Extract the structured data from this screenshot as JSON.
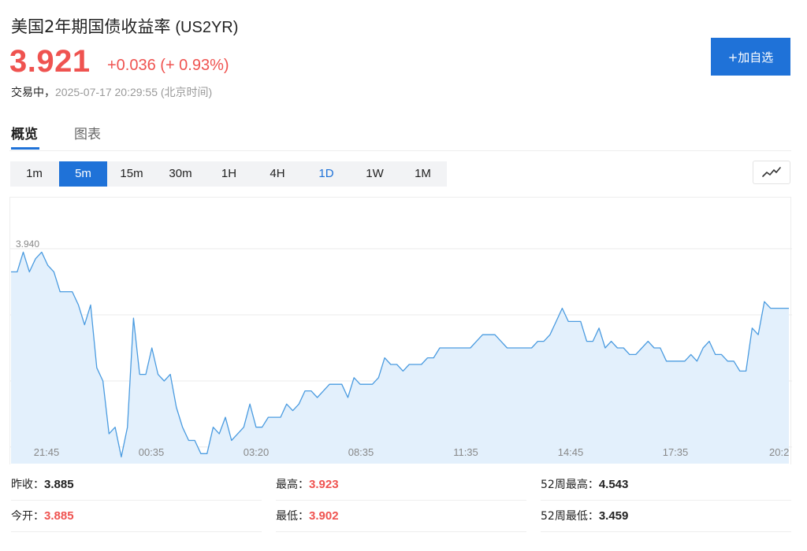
{
  "header": {
    "title": "美国2年期国债收益率",
    "code": "(US2YR)",
    "price": "3.921",
    "change": "+0.036 (+ 0.93%)",
    "status_live": "交易中，",
    "status_time": "2025-07-17 20:29:55 (北京时间)",
    "add_button": "+加自选"
  },
  "tabs": [
    {
      "label": "概览",
      "active": true
    },
    {
      "label": "图表",
      "active": false
    }
  ],
  "periods": [
    "1m",
    "5m",
    "15m",
    "30m",
    "1H",
    "4H",
    "1D",
    "1W",
    "1M"
  ],
  "selected_period": "5m",
  "highlight_period": "1D",
  "colors": {
    "up": "#ef5350",
    "accent": "#1f72d8",
    "line": "#4a9be0",
    "fill": "#e3f0fc"
  },
  "chart_data": {
    "type": "area",
    "y_ticks": [
      "3.940",
      "3.920",
      "3.900",
      "3.880"
    ],
    "x_ticks": [
      "21:45",
      "00:35",
      "03:20",
      "08:35",
      "11:35",
      "14:45",
      "17:35",
      "20:2"
    ],
    "ylim": [
      3.8745,
      3.9555
    ],
    "grid": true,
    "y": [
      3.933,
      3.933,
      3.939,
      3.933,
      3.937,
      3.939,
      3.935,
      3.933,
      3.927,
      3.927,
      3.927,
      3.923,
      3.917,
      3.923,
      3.904,
      3.9,
      3.884,
      3.886,
      3.877,
      3.886,
      3.919,
      3.902,
      3.902,
      3.91,
      3.902,
      3.9,
      3.902,
      3.892,
      3.886,
      3.882,
      3.882,
      3.878,
      3.878,
      3.886,
      3.884,
      3.889,
      3.882,
      3.884,
      3.886,
      3.893,
      3.886,
      3.886,
      3.889,
      3.889,
      3.889,
      3.893,
      3.891,
      3.893,
      3.897,
      3.897,
      3.895,
      3.897,
      3.899,
      3.899,
      3.899,
      3.895,
      3.901,
      3.899,
      3.899,
      3.899,
      3.901,
      3.907,
      3.905,
      3.905,
      3.903,
      3.905,
      3.905,
      3.905,
      3.907,
      3.907,
      3.91,
      3.91,
      3.91,
      3.91,
      3.91,
      3.91,
      3.912,
      3.914,
      3.914,
      3.914,
      3.912,
      3.91,
      3.91,
      3.91,
      3.91,
      3.91,
      3.912,
      3.912,
      3.914,
      3.918,
      3.922,
      3.918,
      3.918,
      3.918,
      3.912,
      3.912,
      3.916,
      3.91,
      3.912,
      3.91,
      3.91,
      3.908,
      3.908,
      3.91,
      3.912,
      3.91,
      3.91,
      3.906,
      3.906,
      3.906,
      3.906,
      3.908,
      3.906,
      3.91,
      3.912,
      3.908,
      3.908,
      3.906,
      3.906,
      3.903,
      3.903,
      3.916,
      3.914,
      3.924,
      3.922,
      3.922,
      3.922,
      3.922
    ]
  },
  "stats": [
    {
      "label": "昨收：",
      "value": "3.885",
      "red": false
    },
    {
      "label": "最高：",
      "value": "3.923",
      "red": true
    },
    {
      "label": "52周最高：",
      "value": "4.543",
      "red": false
    },
    {
      "label": "今开：",
      "value": "3.885",
      "red": true
    },
    {
      "label": "最低：",
      "value": "3.902",
      "red": true
    },
    {
      "label": "52周最低：",
      "value": "3.459",
      "red": false
    }
  ]
}
